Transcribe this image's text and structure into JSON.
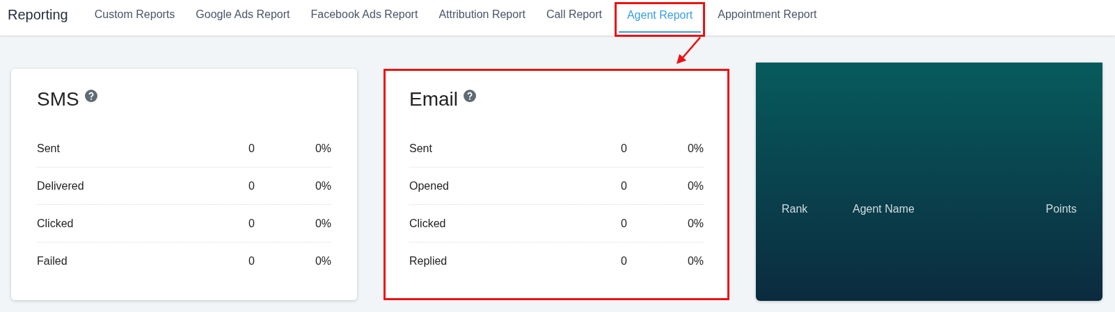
{
  "header": {
    "title": "Reporting"
  },
  "tabs": [
    {
      "label": "Custom Reports",
      "selected": false,
      "annotated": false
    },
    {
      "label": "Google Ads Report",
      "selected": false,
      "annotated": false
    },
    {
      "label": "Facebook Ads Report",
      "selected": false,
      "annotated": false
    },
    {
      "label": "Attribution Report",
      "selected": false,
      "annotated": false
    },
    {
      "label": "Call Report",
      "selected": false,
      "annotated": false
    },
    {
      "label": "Agent Report",
      "selected": true,
      "annotated": true
    },
    {
      "label": "Appointment Report",
      "selected": false,
      "annotated": false
    }
  ],
  "stat_cards": [
    {
      "title": "SMS",
      "annotated": false,
      "rows": [
        {
          "label": "Sent",
          "count": "0",
          "percent": "0%"
        },
        {
          "label": "Delivered",
          "count": "0",
          "percent": "0%"
        },
        {
          "label": "Clicked",
          "count": "0",
          "percent": "0%"
        },
        {
          "label": "Failed",
          "count": "0",
          "percent": "0%"
        }
      ]
    },
    {
      "title": "Email",
      "annotated": true,
      "rows": [
        {
          "label": "Sent",
          "count": "0",
          "percent": "0%"
        },
        {
          "label": "Opened",
          "count": "0",
          "percent": "0%"
        },
        {
          "label": "Clicked",
          "count": "0",
          "percent": "0%"
        },
        {
          "label": "Replied",
          "count": "0",
          "percent": "0%"
        }
      ]
    }
  ],
  "leaderboard": {
    "columns": [
      "Rank",
      "Agent Name",
      "Points"
    ]
  }
}
